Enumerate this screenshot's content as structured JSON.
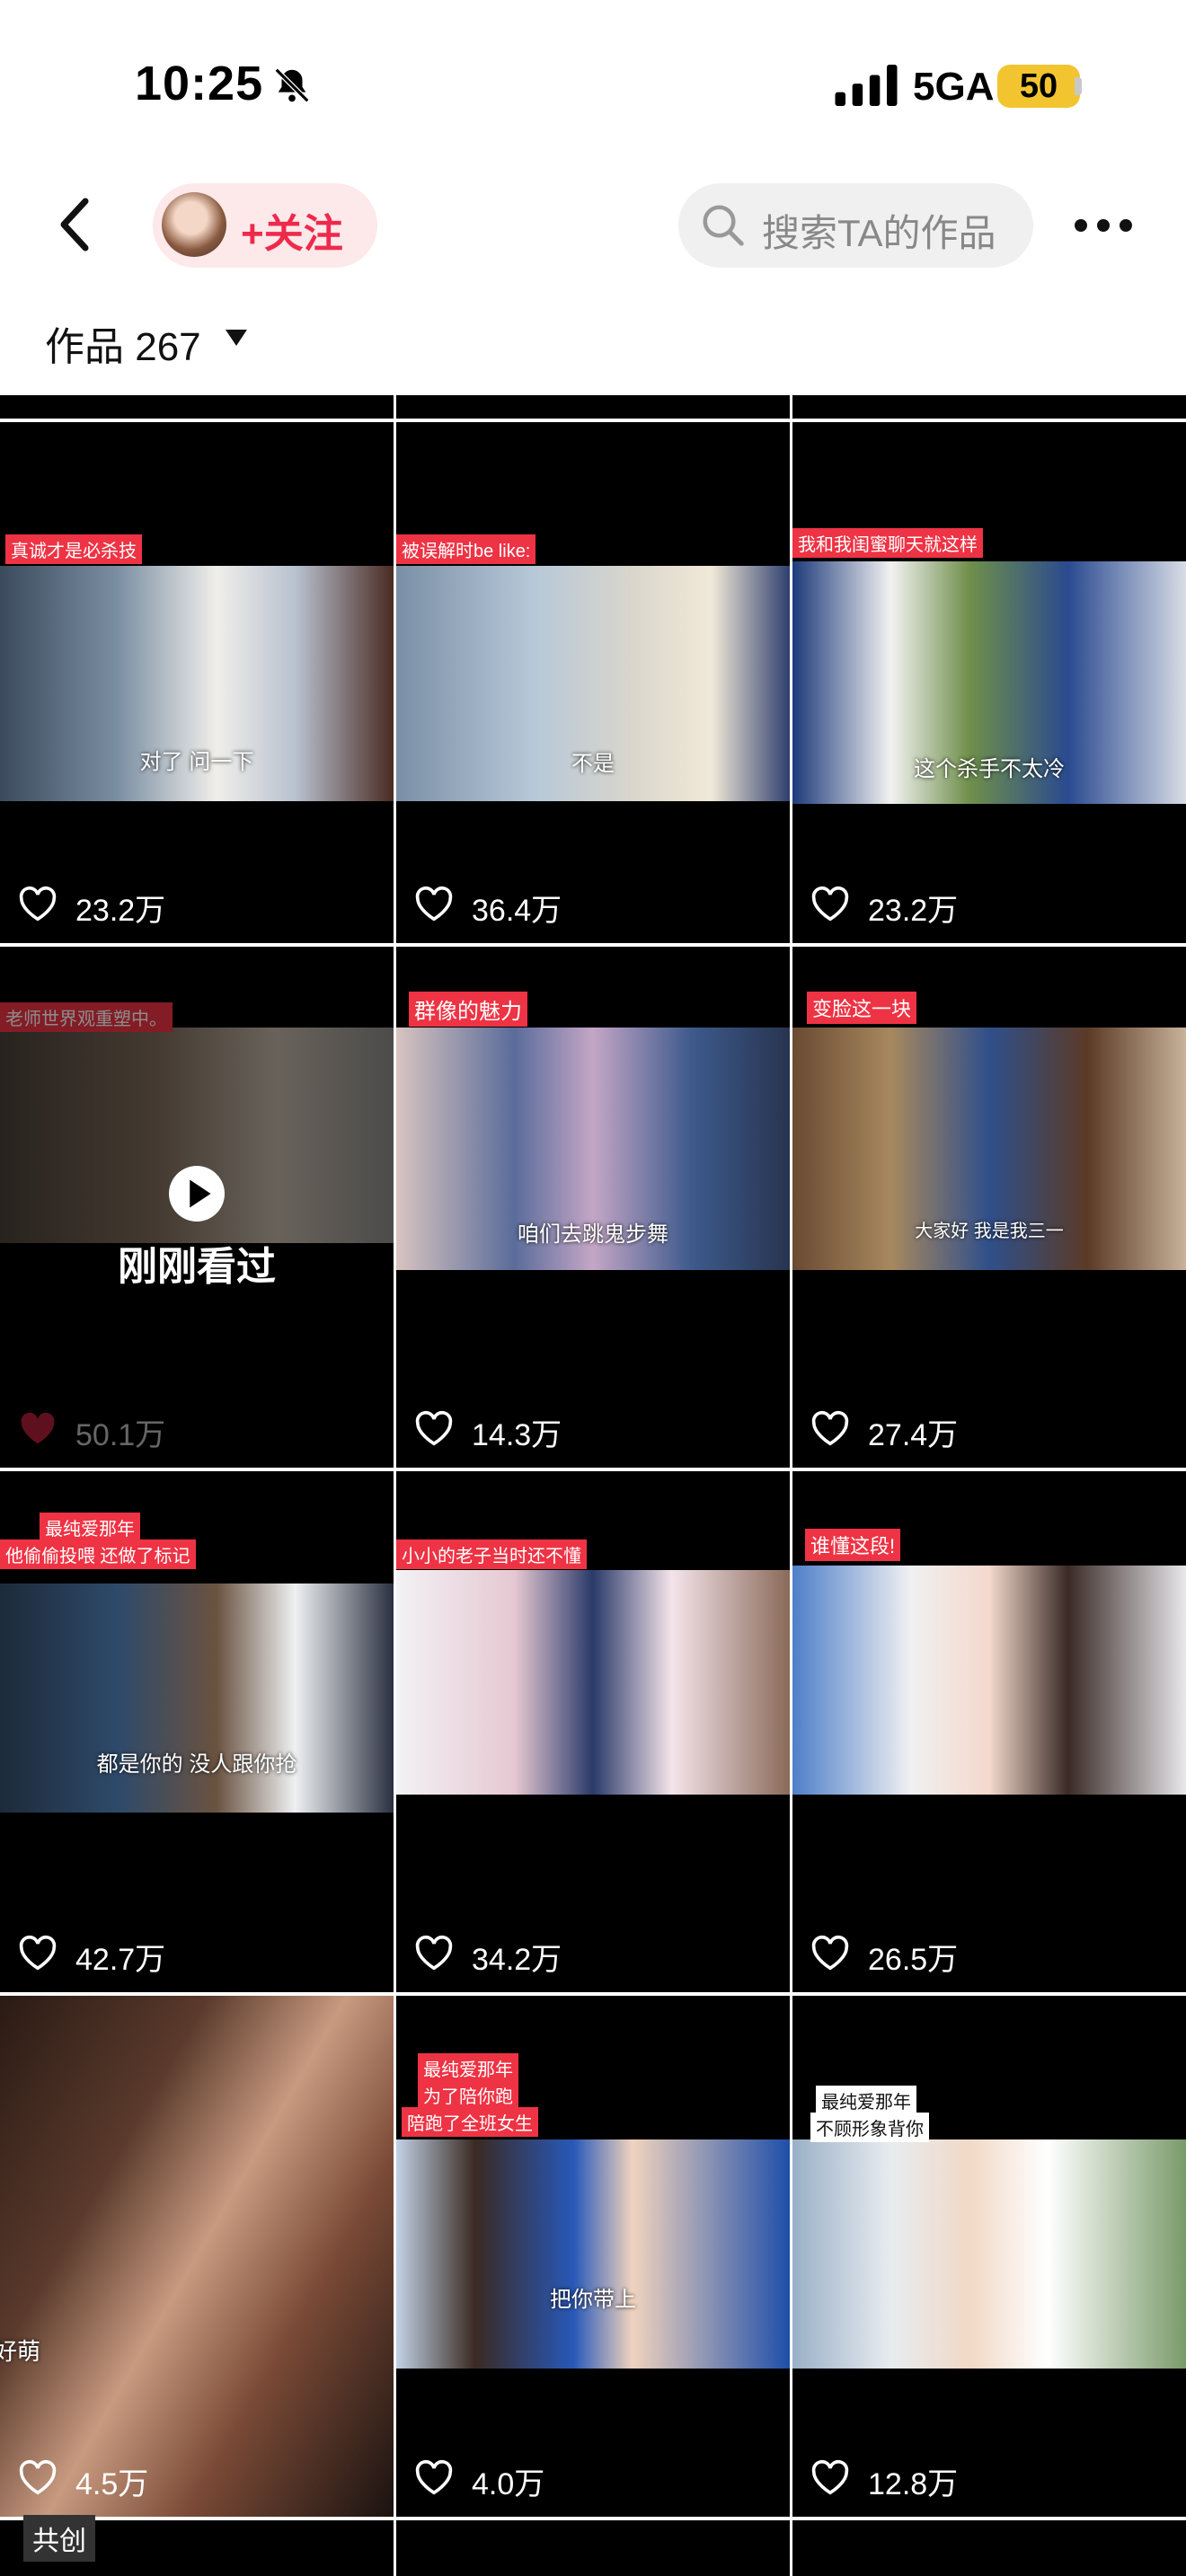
{
  "status": {
    "time": "10:25",
    "network": "5GA",
    "battery": "50"
  },
  "nav": {
    "follow_label": "+关注",
    "search_placeholder": "搜索TA的作品"
  },
  "works": {
    "label": "作品 267"
  },
  "videos": [
    {
      "tag": "真诚才是必杀技",
      "subtitle": "对了 问一下",
      "likes": "23.2万",
      "liked": false
    },
    {
      "tag": "被误解时be like:",
      "subtitle": "不是",
      "likes": "36.4万",
      "liked": false
    },
    {
      "tag": "我和我闺蜜聊天就这样",
      "subtitle": "这个杀手不太冷",
      "likes": "23.2万",
      "liked": false
    },
    {
      "tag": "老师世界观重塑中。",
      "subtitle": "",
      "likes": "50.1万",
      "liked": true,
      "watched_label": "刚刚看过"
    },
    {
      "tag": "群像的魅力",
      "subtitle": "咱们去跳鬼步舞",
      "likes": "14.3万",
      "liked": false
    },
    {
      "tag": "变脸这一块",
      "subtitle": "大家好 我是我三一",
      "likes": "27.4万",
      "liked": false
    },
    {
      "tag": "最纯爱那年",
      "tag2": "他偷偷投喂 还做了标记",
      "subtitle": "都是你的 没人跟你抢",
      "likes": "42.7万",
      "liked": false
    },
    {
      "tag": "小小的老子当时还不懂",
      "subtitle": "",
      "likes": "34.2万",
      "liked": false
    },
    {
      "tag": "谁懂这段!",
      "subtitle": "",
      "likes": "26.5万",
      "liked": false
    },
    {
      "tag": "",
      "subtitle": "好萌",
      "likes": "4.5万",
      "liked": false
    },
    {
      "tag": "最纯爱那年",
      "tag2": "为了陪你跑",
      "tag3": "陪跑了全班女生",
      "subtitle": "把你带上",
      "likes": "4.0万",
      "liked": false
    },
    {
      "tag": "最纯爱那年",
      "tag2": "不顾形象背你",
      "subtitle": "",
      "likes": "12.8万",
      "liked": false
    }
  ],
  "next_row_partial_tag": "共创",
  "colors": {
    "like_red": "#ee2a4c",
    "tag_red": "#ee3344",
    "battery_yellow": "#f2c530"
  }
}
